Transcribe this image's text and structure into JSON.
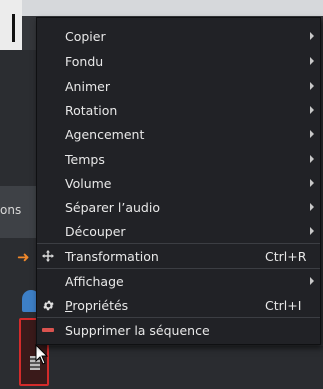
{
  "menu": {
    "items": [
      {
        "label": "Copier",
        "submenu": true
      },
      {
        "label": "Fondu",
        "submenu": true
      },
      {
        "label": "Animer",
        "submenu": true
      },
      {
        "label": "Rotation",
        "submenu": true
      },
      {
        "label": "Agencement",
        "submenu": true
      },
      {
        "label": "Temps",
        "submenu": true
      },
      {
        "label": "Volume",
        "submenu": true
      },
      {
        "label": "Séparer l’audio",
        "submenu": true
      },
      {
        "label": "Découper",
        "submenu": true
      },
      {
        "label": "Transformation",
        "shortcut": "Ctrl+R",
        "icon": "move-arrows-icon"
      },
      {
        "label": "Affichage",
        "submenu": true
      },
      {
        "label_first": "P",
        "label_rest": "ropriétés",
        "shortcut": "Ctrl+I",
        "icon": "gear-icon"
      },
      {
        "label": "Supprimer la séquence",
        "icon": "remove-icon"
      }
    ]
  },
  "background": {
    "left_panel_text": "ons"
  },
  "colors": {
    "menu_bg": "#212226",
    "text": "#e8e8e8",
    "delete_icon": "#d9534f",
    "clip_border": "#d42b2b"
  }
}
